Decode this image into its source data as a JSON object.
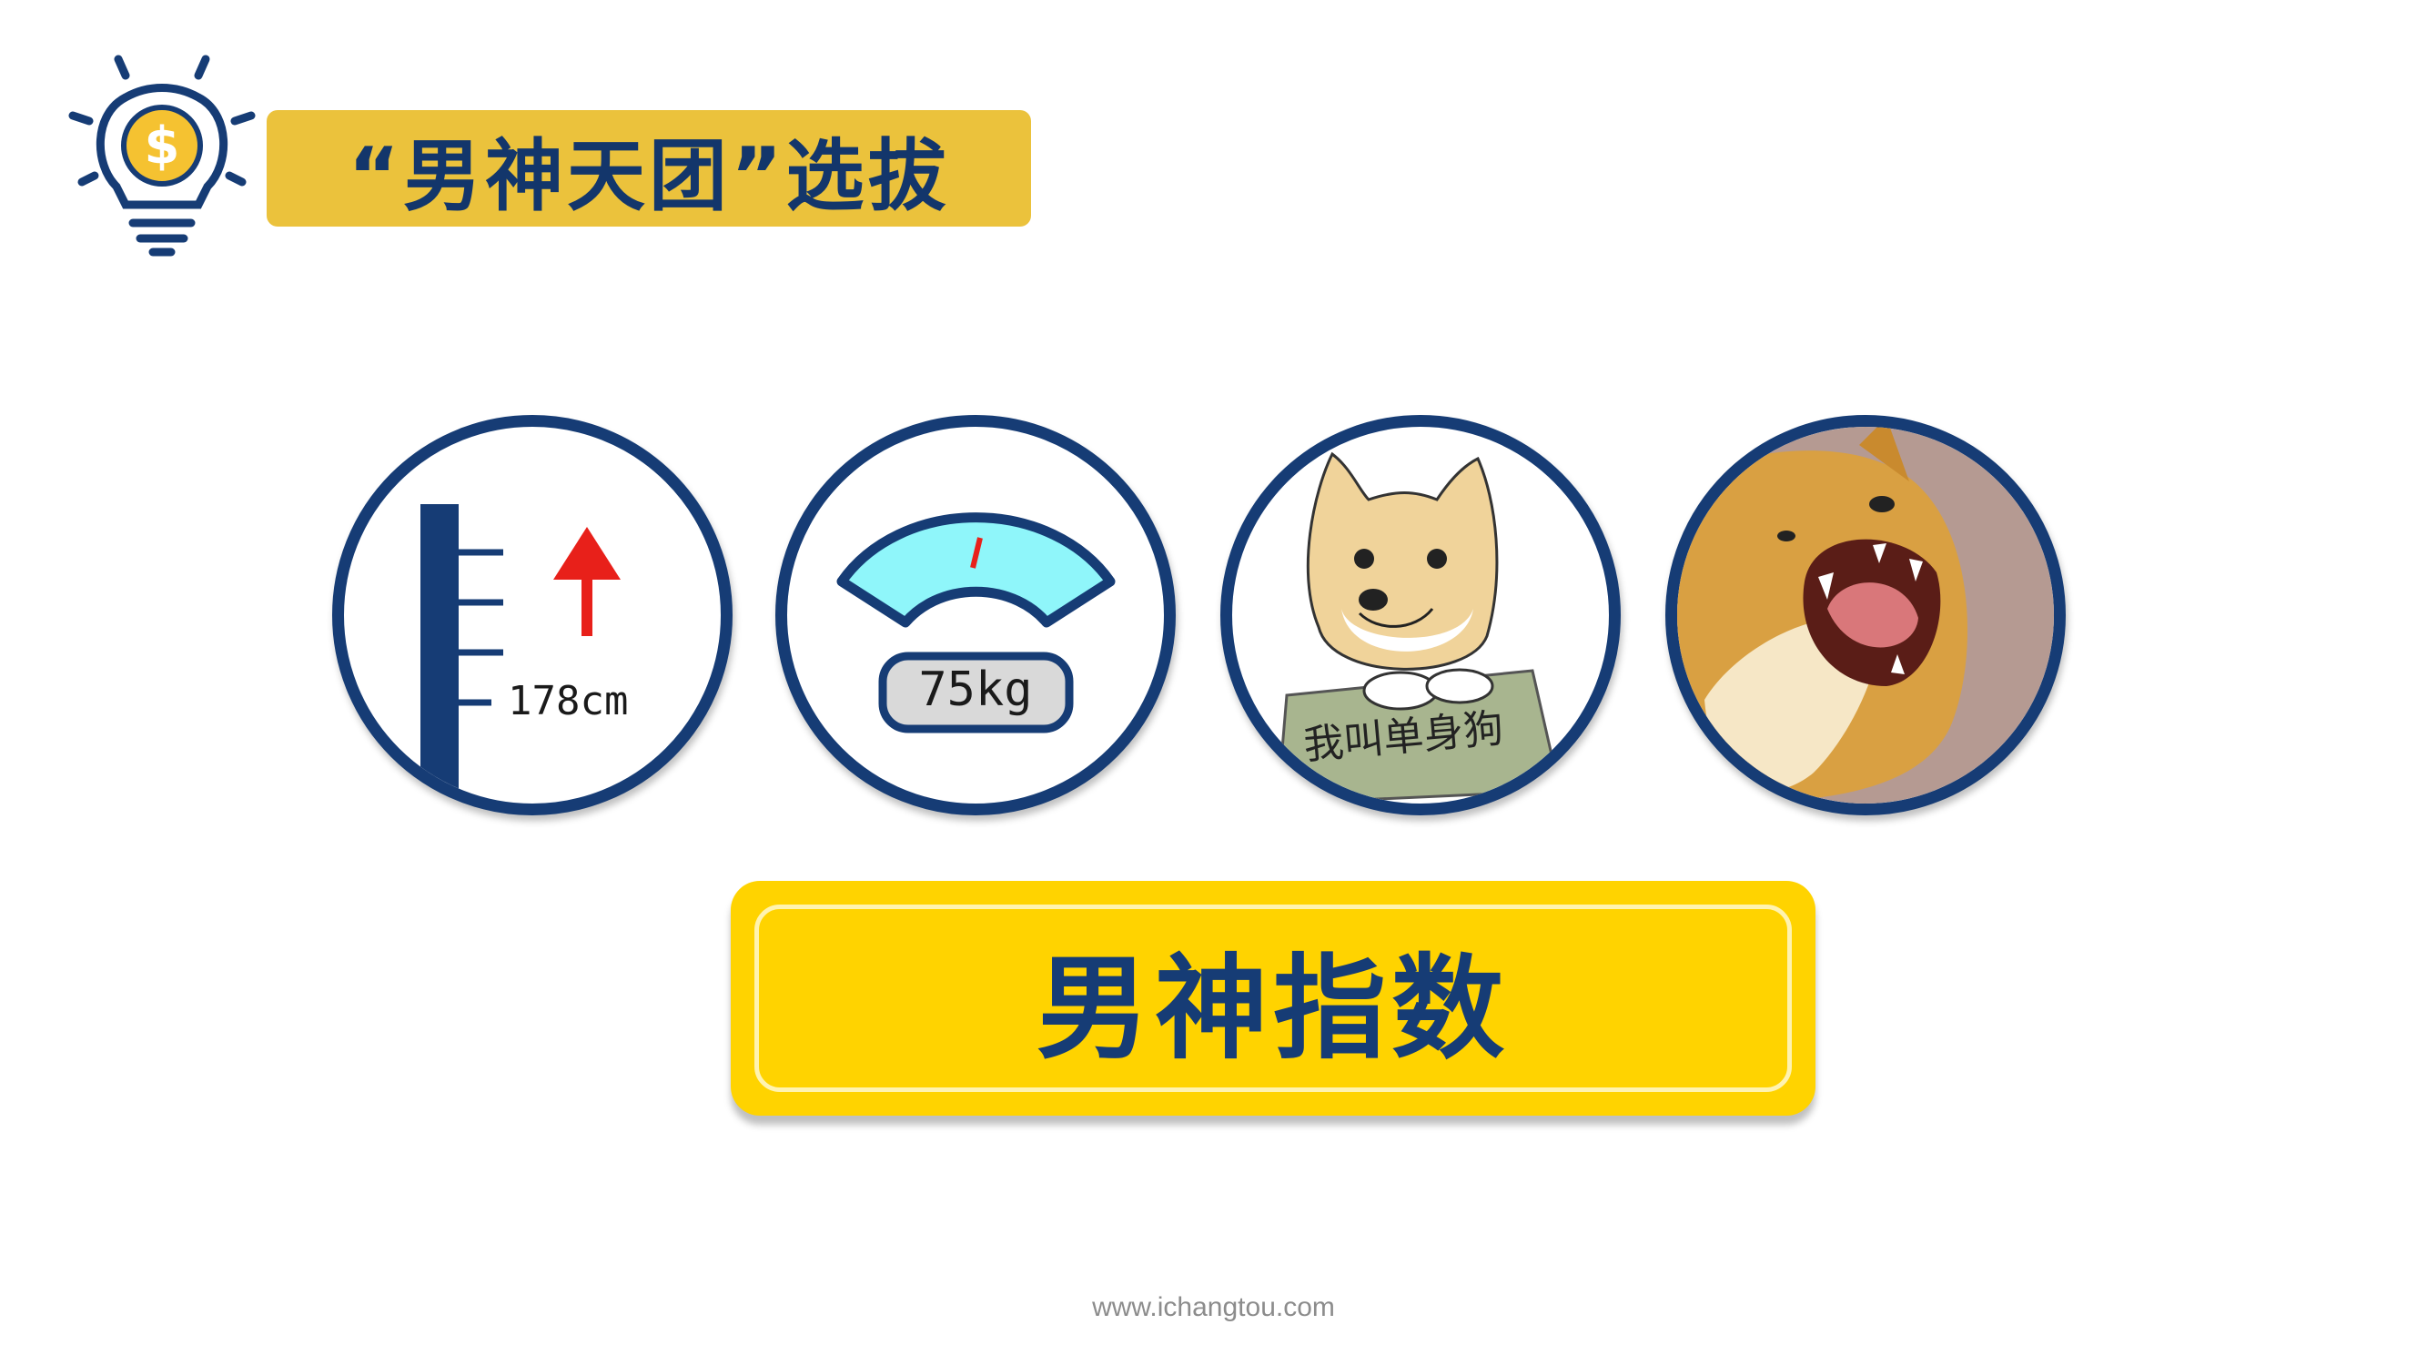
{
  "header": {
    "title": "“男神天团”选拔",
    "logo_icon": "lightbulb-dollar-icon"
  },
  "cards": [
    {
      "icon": "height-ruler-icon",
      "label": "178cm"
    },
    {
      "icon": "weight-scale-icon",
      "label": "75kg"
    },
    {
      "icon": "doge-sign-image",
      "label": "我叫单身狗"
    },
    {
      "icon": "barking-shiba-image"
    }
  ],
  "index_banner": {
    "label": "男神指数"
  },
  "footer": {
    "url": "www.ichangtou.com"
  },
  "colors": {
    "navy": "#163c75",
    "title_yellow": "#ebc23c",
    "banner_yellow": "#ffd300",
    "arrow_red": "#e8201a",
    "gauge_cyan": "#8ff6fa"
  }
}
